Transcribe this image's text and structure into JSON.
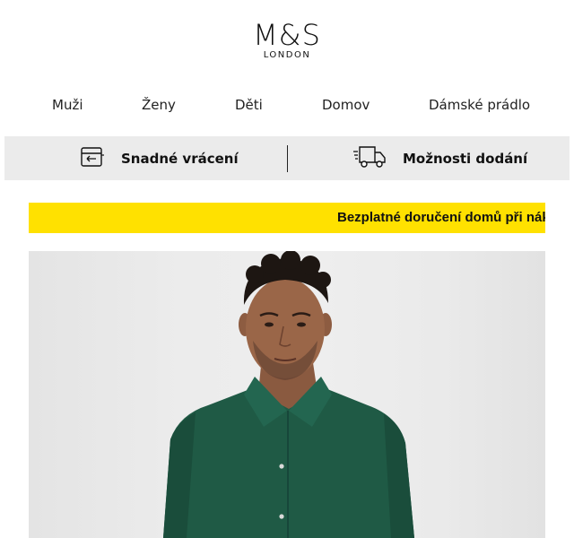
{
  "logo": {
    "main": "M&S",
    "sub": "LONDON"
  },
  "nav": {
    "items": [
      {
        "label": "Muži"
      },
      {
        "label": "Ženy"
      },
      {
        "label": "Děti"
      },
      {
        "label": "Domov"
      },
      {
        "label": "Dámské prádlo"
      }
    ]
  },
  "services": {
    "returns": {
      "label": "Snadné vrácení",
      "icon": "card-return-icon"
    },
    "delivery": {
      "label": "Možnosti dodání",
      "icon": "delivery-truck-icon"
    }
  },
  "promo": {
    "text": "Bezplatné doručení domů při nák",
    "background": "#ffe100"
  },
  "hero": {
    "image": "man-in-green-shirt-photo",
    "shirt_color": "#1f5a45"
  }
}
